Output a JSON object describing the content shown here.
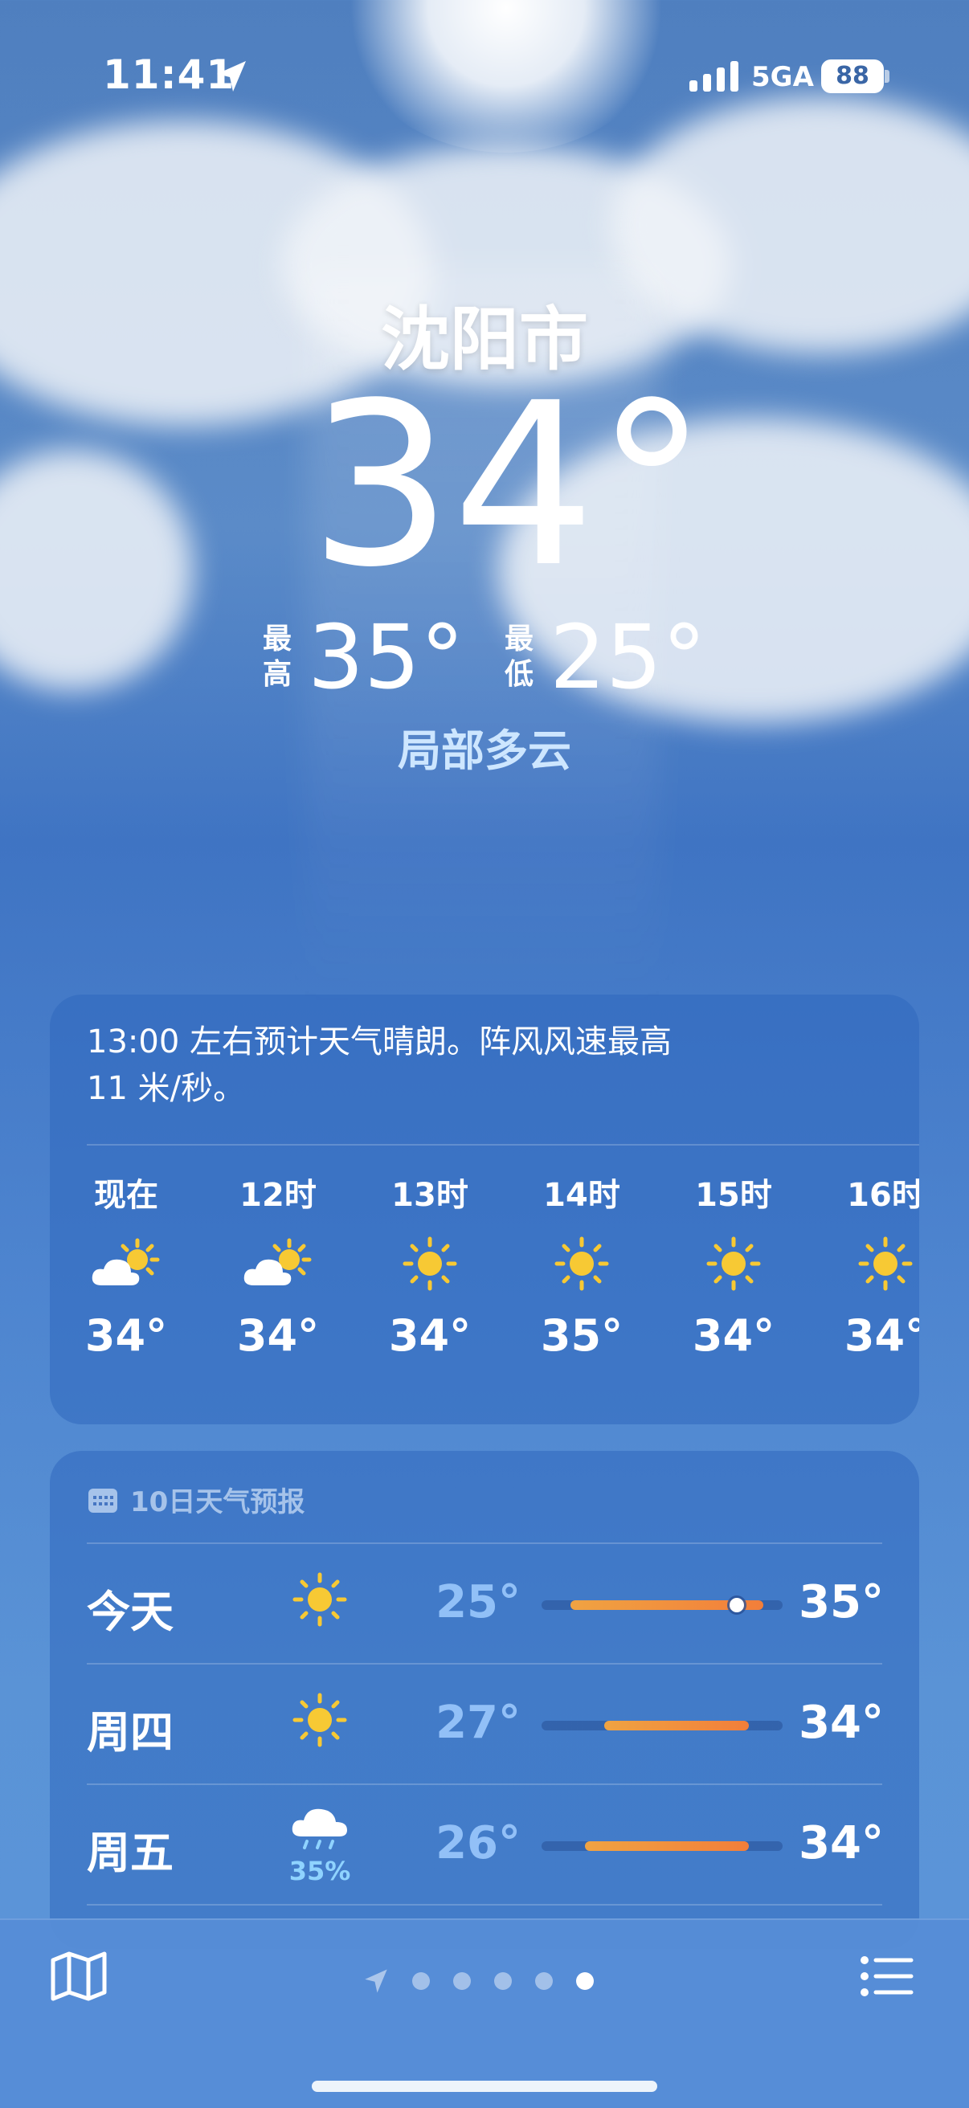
{
  "status_bar": {
    "time": "11:41",
    "network": "5GA",
    "battery": "88"
  },
  "location": {
    "city": "沈阳市"
  },
  "current": {
    "temperature": "34°",
    "high_label": [
      "最",
      "高"
    ],
    "high": "35°",
    "low_label": [
      "最",
      "低"
    ],
    "low": "25°",
    "condition": "局部多云"
  },
  "hourly": {
    "summary_line1": "13:00 左右预计天气晴朗。阵风风速最高",
    "summary_line2": "11 米/秒。",
    "items": [
      {
        "label": "现在",
        "icon": "partly-sunny-icon",
        "temp": "34°"
      },
      {
        "label": "12时",
        "icon": "partly-sunny-icon",
        "temp": "34°"
      },
      {
        "label": "13时",
        "icon": "sun-icon",
        "temp": "34°"
      },
      {
        "label": "14时",
        "icon": "sun-icon",
        "temp": "35°"
      },
      {
        "label": "15时",
        "icon": "sun-icon",
        "temp": "34°"
      },
      {
        "label": "16时",
        "icon": "sun-icon",
        "temp": "34°"
      }
    ]
  },
  "forecast": {
    "title": "10日天气预报",
    "days": [
      {
        "day": "今天",
        "icon": "sun-icon",
        "precip": "",
        "low": "25°",
        "high": "35°",
        "bar_start": 0.12,
        "bar_end": 0.92,
        "current_marker": 0.81
      },
      {
        "day": "周四",
        "icon": "sun-icon",
        "precip": "",
        "low": "27°",
        "high": "34°",
        "bar_start": 0.26,
        "bar_end": 0.86
      },
      {
        "day": "周五",
        "icon": "rain-cloud-icon",
        "precip": "35%",
        "low": "26°",
        "high": "34°",
        "bar_start": 0.18,
        "bar_end": 0.86
      }
    ]
  },
  "colors": {
    "sun": "#f7c934",
    "bar_start": "#f0a342",
    "bar_end": "#f27e3a",
    "condition": "#cde6ff"
  }
}
